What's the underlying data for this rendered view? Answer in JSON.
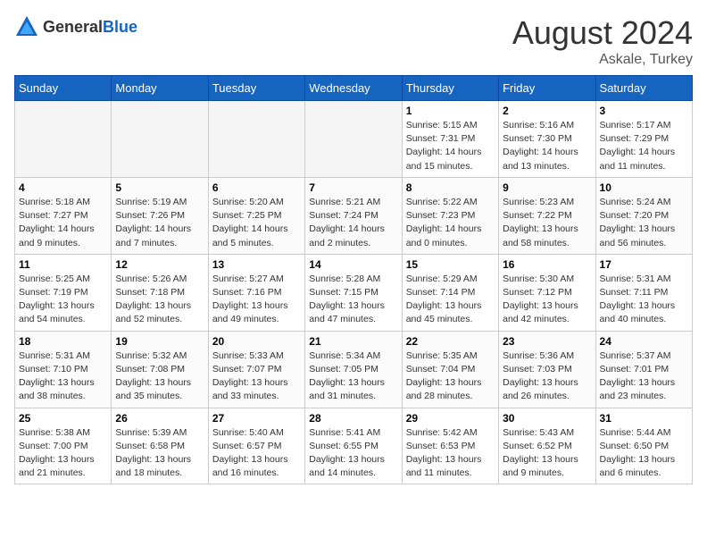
{
  "header": {
    "logo_general": "General",
    "logo_blue": "Blue",
    "title": "August 2024",
    "subtitle": "Askale, Turkey"
  },
  "days_of_week": [
    "Sunday",
    "Monday",
    "Tuesday",
    "Wednesday",
    "Thursday",
    "Friday",
    "Saturday"
  ],
  "weeks": [
    [
      {
        "day": "",
        "info": ""
      },
      {
        "day": "",
        "info": ""
      },
      {
        "day": "",
        "info": ""
      },
      {
        "day": "",
        "info": ""
      },
      {
        "day": "1",
        "info": "Sunrise: 5:15 AM\nSunset: 7:31 PM\nDaylight: 14 hours\nand 15 minutes."
      },
      {
        "day": "2",
        "info": "Sunrise: 5:16 AM\nSunset: 7:30 PM\nDaylight: 14 hours\nand 13 minutes."
      },
      {
        "day": "3",
        "info": "Sunrise: 5:17 AM\nSunset: 7:29 PM\nDaylight: 14 hours\nand 11 minutes."
      }
    ],
    [
      {
        "day": "4",
        "info": "Sunrise: 5:18 AM\nSunset: 7:27 PM\nDaylight: 14 hours\nand 9 minutes."
      },
      {
        "day": "5",
        "info": "Sunrise: 5:19 AM\nSunset: 7:26 PM\nDaylight: 14 hours\nand 7 minutes."
      },
      {
        "day": "6",
        "info": "Sunrise: 5:20 AM\nSunset: 7:25 PM\nDaylight: 14 hours\nand 5 minutes."
      },
      {
        "day": "7",
        "info": "Sunrise: 5:21 AM\nSunset: 7:24 PM\nDaylight: 14 hours\nand 2 minutes."
      },
      {
        "day": "8",
        "info": "Sunrise: 5:22 AM\nSunset: 7:23 PM\nDaylight: 14 hours\nand 0 minutes."
      },
      {
        "day": "9",
        "info": "Sunrise: 5:23 AM\nSunset: 7:22 PM\nDaylight: 13 hours\nand 58 minutes."
      },
      {
        "day": "10",
        "info": "Sunrise: 5:24 AM\nSunset: 7:20 PM\nDaylight: 13 hours\nand 56 minutes."
      }
    ],
    [
      {
        "day": "11",
        "info": "Sunrise: 5:25 AM\nSunset: 7:19 PM\nDaylight: 13 hours\nand 54 minutes."
      },
      {
        "day": "12",
        "info": "Sunrise: 5:26 AM\nSunset: 7:18 PM\nDaylight: 13 hours\nand 52 minutes."
      },
      {
        "day": "13",
        "info": "Sunrise: 5:27 AM\nSunset: 7:16 PM\nDaylight: 13 hours\nand 49 minutes."
      },
      {
        "day": "14",
        "info": "Sunrise: 5:28 AM\nSunset: 7:15 PM\nDaylight: 13 hours\nand 47 minutes."
      },
      {
        "day": "15",
        "info": "Sunrise: 5:29 AM\nSunset: 7:14 PM\nDaylight: 13 hours\nand 45 minutes."
      },
      {
        "day": "16",
        "info": "Sunrise: 5:30 AM\nSunset: 7:12 PM\nDaylight: 13 hours\nand 42 minutes."
      },
      {
        "day": "17",
        "info": "Sunrise: 5:31 AM\nSunset: 7:11 PM\nDaylight: 13 hours\nand 40 minutes."
      }
    ],
    [
      {
        "day": "18",
        "info": "Sunrise: 5:31 AM\nSunset: 7:10 PM\nDaylight: 13 hours\nand 38 minutes."
      },
      {
        "day": "19",
        "info": "Sunrise: 5:32 AM\nSunset: 7:08 PM\nDaylight: 13 hours\nand 35 minutes."
      },
      {
        "day": "20",
        "info": "Sunrise: 5:33 AM\nSunset: 7:07 PM\nDaylight: 13 hours\nand 33 minutes."
      },
      {
        "day": "21",
        "info": "Sunrise: 5:34 AM\nSunset: 7:05 PM\nDaylight: 13 hours\nand 31 minutes."
      },
      {
        "day": "22",
        "info": "Sunrise: 5:35 AM\nSunset: 7:04 PM\nDaylight: 13 hours\nand 28 minutes."
      },
      {
        "day": "23",
        "info": "Sunrise: 5:36 AM\nSunset: 7:03 PM\nDaylight: 13 hours\nand 26 minutes."
      },
      {
        "day": "24",
        "info": "Sunrise: 5:37 AM\nSunset: 7:01 PM\nDaylight: 13 hours\nand 23 minutes."
      }
    ],
    [
      {
        "day": "25",
        "info": "Sunrise: 5:38 AM\nSunset: 7:00 PM\nDaylight: 13 hours\nand 21 minutes."
      },
      {
        "day": "26",
        "info": "Sunrise: 5:39 AM\nSunset: 6:58 PM\nDaylight: 13 hours\nand 18 minutes."
      },
      {
        "day": "27",
        "info": "Sunrise: 5:40 AM\nSunset: 6:57 PM\nDaylight: 13 hours\nand 16 minutes."
      },
      {
        "day": "28",
        "info": "Sunrise: 5:41 AM\nSunset: 6:55 PM\nDaylight: 13 hours\nand 14 minutes."
      },
      {
        "day": "29",
        "info": "Sunrise: 5:42 AM\nSunset: 6:53 PM\nDaylight: 13 hours\nand 11 minutes."
      },
      {
        "day": "30",
        "info": "Sunrise: 5:43 AM\nSunset: 6:52 PM\nDaylight: 13 hours\nand 9 minutes."
      },
      {
        "day": "31",
        "info": "Sunrise: 5:44 AM\nSunset: 6:50 PM\nDaylight: 13 hours\nand 6 minutes."
      }
    ]
  ]
}
